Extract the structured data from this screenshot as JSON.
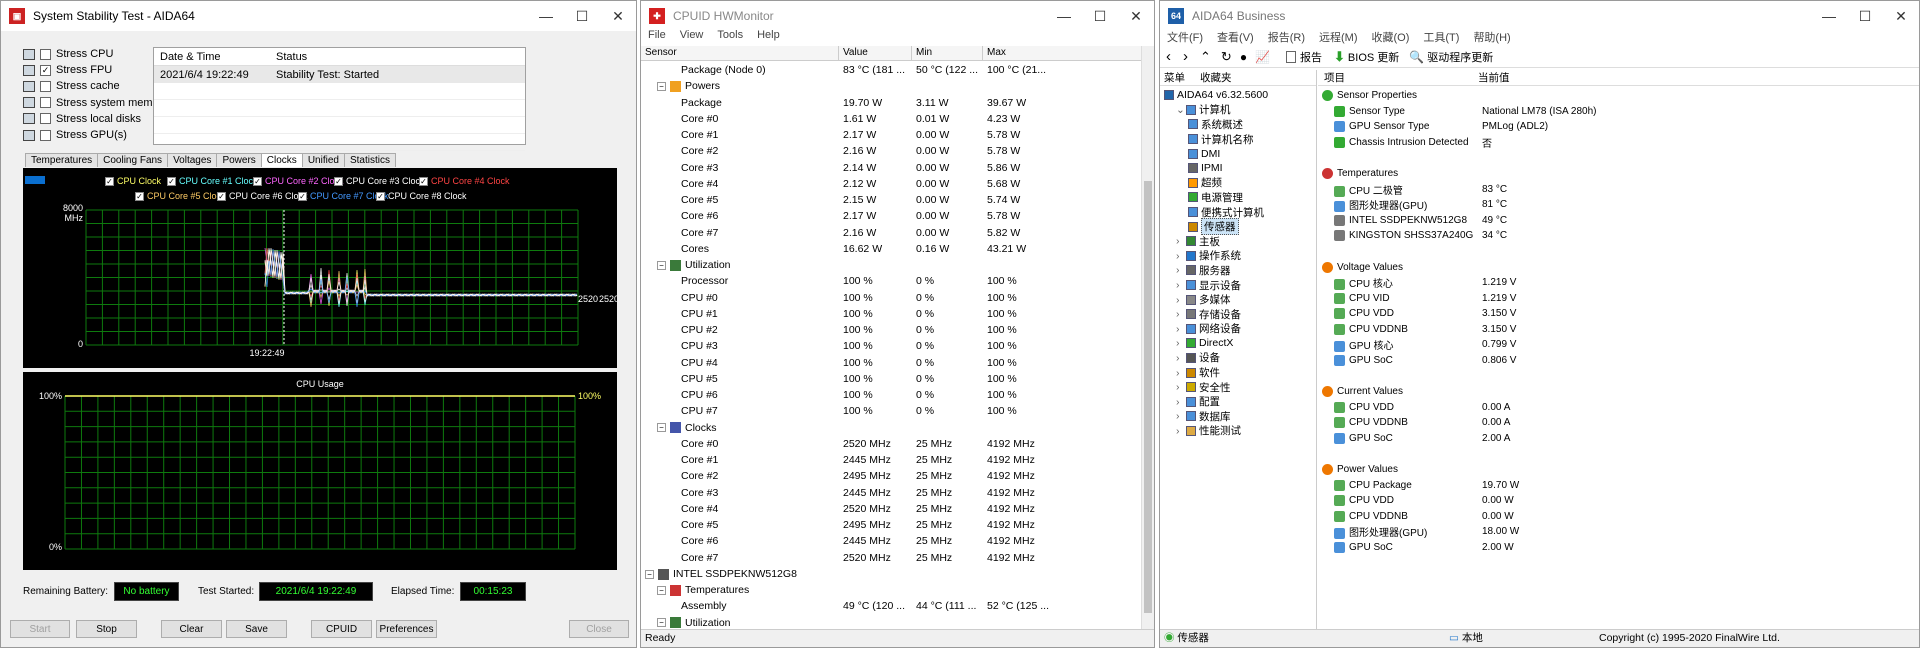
{
  "stability": {
    "title": "System Stability Test - AIDA64",
    "stress_items": [
      {
        "label": "Stress CPU",
        "checked": false
      },
      {
        "label": "Stress FPU",
        "checked": true
      },
      {
        "label": "Stress cache",
        "checked": false
      },
      {
        "label": "Stress system memory",
        "checked": false
      },
      {
        "label": "Stress local disks",
        "checked": false
      },
      {
        "label": "Stress GPU(s)",
        "checked": false
      }
    ],
    "log_header": {
      "datetime": "Date & Time",
      "status": "Status"
    },
    "log_row": {
      "datetime": "2021/6/4 19:22:49",
      "status": "Stability Test: Started"
    },
    "tabs": [
      "Temperatures",
      "Cooling Fans",
      "Voltages",
      "Powers",
      "Clocks",
      "Unified",
      "Statistics"
    ],
    "active_tab": "Clocks",
    "legend": [
      {
        "label": "CPU Clock",
        "color": "#ffff66"
      },
      {
        "label": "CPU Core #1 Clock",
        "color": "#66ffff"
      },
      {
        "label": "CPU Core #2 Clock",
        "color": "#ff66ff"
      },
      {
        "label": "CPU Core #3 Clock",
        "color": "#ffffff"
      },
      {
        "label": "CPU Core #4 Clock",
        "color": "#ff4444"
      },
      {
        "label": "CPU Core #5 Clock",
        "color": "#ffcc66"
      },
      {
        "label": "CPU Core #6 Clock",
        "color": "#ffffff"
      },
      {
        "label": "CPU Core #7 Clock",
        "color": "#4499ff"
      },
      {
        "label": "CPU Core #8 Clock",
        "color": "#ffffff"
      }
    ],
    "clock_graph": {
      "ymax": "8000",
      "unit": "MHz",
      "ymin": "0",
      "time": "19:22:49",
      "value": "2520",
      "value2": "2520"
    },
    "usage_graph": {
      "title": "CPU Usage",
      "top_left": "100%",
      "top_right": "100%",
      "bottom_left": "0%"
    },
    "remaining_battery_label": "Remaining Battery:",
    "remaining_battery": "No battery",
    "test_started_label": "Test Started:",
    "test_started": "2021/6/4 19:22:49",
    "elapsed_label": "Elapsed Time:",
    "elapsed": "00:15:23",
    "buttons": {
      "start": "Start",
      "stop": "Stop",
      "clear": "Clear",
      "save": "Save",
      "cpuid": "CPUID",
      "preferences": "Preferences",
      "close": "Close"
    }
  },
  "hwmonitor": {
    "title": "CPUID HWMonitor",
    "menu": [
      "File",
      "View",
      "Tools",
      "Help"
    ],
    "columns": [
      "Sensor",
      "Value",
      "Min",
      "Max"
    ],
    "rows": [
      {
        "indent": 3,
        "name": "Package (Node 0)",
        "value": "83 °C (181 ...",
        "min": "50 °C (122 ...",
        "max": "100 °C (21..."
      },
      {
        "indent": 1,
        "group": true,
        "icon": "power",
        "name": "Powers"
      },
      {
        "indent": 3,
        "name": "Package",
        "value": "19.70 W",
        "min": "3.11 W",
        "max": "39.67 W"
      },
      {
        "indent": 3,
        "name": "Core #0",
        "value": "1.61 W",
        "min": "0.01 W",
        "max": "4.23 W"
      },
      {
        "indent": 3,
        "name": "Core #1",
        "value": "2.17 W",
        "min": "0.00 W",
        "max": "5.78 W"
      },
      {
        "indent": 3,
        "name": "Core #2",
        "value": "2.16 W",
        "min": "0.00 W",
        "max": "5.78 W"
      },
      {
        "indent": 3,
        "name": "Core #3",
        "value": "2.14 W",
        "min": "0.00 W",
        "max": "5.86 W"
      },
      {
        "indent": 3,
        "name": "Core #4",
        "value": "2.12 W",
        "min": "0.00 W",
        "max": "5.68 W"
      },
      {
        "indent": 3,
        "name": "Core #5",
        "value": "2.15 W",
        "min": "0.00 W",
        "max": "5.74 W"
      },
      {
        "indent": 3,
        "name": "Core #6",
        "value": "2.17 W",
        "min": "0.00 W",
        "max": "5.78 W"
      },
      {
        "indent": 3,
        "name": "Core #7",
        "value": "2.16 W",
        "min": "0.00 W",
        "max": "5.82 W"
      },
      {
        "indent": 3,
        "name": "Cores",
        "value": "16.62 W",
        "min": "0.16 W",
        "max": "43.21 W"
      },
      {
        "indent": 1,
        "group": true,
        "icon": "util",
        "name": "Utilization"
      },
      {
        "indent": 3,
        "name": "Processor",
        "value": "100 %",
        "min": "0 %",
        "max": "100 %"
      },
      {
        "indent": 3,
        "name": "CPU #0",
        "value": "100 %",
        "min": "0 %",
        "max": "100 %"
      },
      {
        "indent": 3,
        "name": "CPU #1",
        "value": "100 %",
        "min": "0 %",
        "max": "100 %"
      },
      {
        "indent": 3,
        "name": "CPU #2",
        "value": "100 %",
        "min": "0 %",
        "max": "100 %"
      },
      {
        "indent": 3,
        "name": "CPU #3",
        "value": "100 %",
        "min": "0 %",
        "max": "100 %"
      },
      {
        "indent": 3,
        "name": "CPU #4",
        "value": "100 %",
        "min": "0 %",
        "max": "100 %"
      },
      {
        "indent": 3,
        "name": "CPU #5",
        "value": "100 %",
        "min": "0 %",
        "max": "100 %"
      },
      {
        "indent": 3,
        "name": "CPU #6",
        "value": "100 %",
        "min": "0 %",
        "max": "100 %"
      },
      {
        "indent": 3,
        "name": "CPU #7",
        "value": "100 %",
        "min": "0 %",
        "max": "100 %"
      },
      {
        "indent": 1,
        "group": true,
        "icon": "clock",
        "name": "Clocks"
      },
      {
        "indent": 3,
        "name": "Core #0",
        "value": "2520 MHz",
        "min": "25 MHz",
        "max": "4192 MHz"
      },
      {
        "indent": 3,
        "name": "Core #1",
        "value": "2445 MHz",
        "min": "25 MHz",
        "max": "4192 MHz"
      },
      {
        "indent": 3,
        "name": "Core #2",
        "value": "2495 MHz",
        "min": "25 MHz",
        "max": "4192 MHz"
      },
      {
        "indent": 3,
        "name": "Core #3",
        "value": "2445 MHz",
        "min": "25 MHz",
        "max": "4192 MHz"
      },
      {
        "indent": 3,
        "name": "Core #4",
        "value": "2520 MHz",
        "min": "25 MHz",
        "max": "4192 MHz"
      },
      {
        "indent": 3,
        "name": "Core #5",
        "value": "2495 MHz",
        "min": "25 MHz",
        "max": "4192 MHz"
      },
      {
        "indent": 3,
        "name": "Core #6",
        "value": "2445 MHz",
        "min": "25 MHz",
        "max": "4192 MHz"
      },
      {
        "indent": 3,
        "name": "Core #7",
        "value": "2520 MHz",
        "min": "25 MHz",
        "max": "4192 MHz"
      },
      {
        "indent": 0,
        "group": true,
        "icon": "disk",
        "name": "INTEL SSDPEKNW512G8"
      },
      {
        "indent": 1,
        "group": true,
        "icon": "temp",
        "name": "Temperatures"
      },
      {
        "indent": 3,
        "name": "Assembly",
        "value": "49 °C (120 ...",
        "min": "44 °C (111 ...",
        "max": "52 °C (125 ..."
      },
      {
        "indent": 1,
        "group": true,
        "icon": "util",
        "name": "Utilization"
      }
    ],
    "status": "Ready"
  },
  "aida": {
    "title": "AIDA64 Business",
    "menu": [
      "文件(F)",
      "查看(V)",
      "报告(R)",
      "远程(M)",
      "收藏(O)",
      "工具(T)",
      "帮助(H)"
    ],
    "toolbar": {
      "report": "报告",
      "bios": "BIOS 更新",
      "driver": "驱动程序更新"
    },
    "tree_tabs": [
      "菜单",
      "收藏夹"
    ],
    "tree": [
      {
        "indent": 0,
        "name": "AIDA64 v6.32.5600",
        "color": "#2266aa"
      },
      {
        "indent": 1,
        "name": "计算机",
        "color": "#4a90d9",
        "exp": "-"
      },
      {
        "indent": 2,
        "name": "系统概述",
        "color": "#4a90d9"
      },
      {
        "indent": 2,
        "name": "计算机名称",
        "color": "#4a90d9"
      },
      {
        "indent": 2,
        "name": "DMI",
        "color": "#4a90d9"
      },
      {
        "indent": 2,
        "name": "IPMI",
        "color": "#666666"
      },
      {
        "indent": 2,
        "name": "超频",
        "color": "#ff9900"
      },
      {
        "indent": 2,
        "name": "电源管理",
        "color": "#33aa33"
      },
      {
        "indent": 2,
        "name": "便携式计算机",
        "color": "#4a90d9"
      },
      {
        "indent": 2,
        "name": "传感器",
        "color": "#cc8800",
        "selected": true
      },
      {
        "indent": 1,
        "name": "主板",
        "color": "#338833",
        "exp": ">"
      },
      {
        "indent": 1,
        "name": "操作系统",
        "color": "#2277cc",
        "exp": ">"
      },
      {
        "indent": 1,
        "name": "服务器",
        "color": "#666666",
        "exp": ">"
      },
      {
        "indent": 1,
        "name": "显示设备",
        "color": "#4a90d9",
        "exp": ">"
      },
      {
        "indent": 1,
        "name": "多媒体",
        "color": "#888888",
        "exp": ">"
      },
      {
        "indent": 1,
        "name": "存储设备",
        "color": "#777777",
        "exp": ">"
      },
      {
        "indent": 1,
        "name": "网络设备",
        "color": "#4a90d9",
        "exp": ">"
      },
      {
        "indent": 1,
        "name": "DirectX",
        "color": "#33aa33",
        "exp": ">"
      },
      {
        "indent": 1,
        "name": "设备",
        "color": "#555555",
        "exp": ">"
      },
      {
        "indent": 1,
        "name": "软件",
        "color": "#cc8800",
        "exp": ">"
      },
      {
        "indent": 1,
        "name": "安全性",
        "color": "#ccaa00",
        "exp": ">"
      },
      {
        "indent": 1,
        "name": "配置",
        "color": "#4a90d9",
        "exp": ">"
      },
      {
        "indent": 1,
        "name": "数据库",
        "color": "#4a90d9",
        "exp": ">"
      },
      {
        "indent": 1,
        "name": "性能测试",
        "color": "#ddaa44",
        "exp": ">"
      }
    ],
    "columns": [
      "项目",
      "当前值"
    ],
    "sections": [
      {
        "title": "Sensor Properties",
        "icon_color": "#33aa33",
        "rows": [
          {
            "f": "Sensor Type",
            "v": "National LM78  (ISA 280h)",
            "c": "#33aa33"
          },
          {
            "f": "GPU Sensor Type",
            "v": "PMLog  (ADL2)",
            "c": "#4a90d9"
          },
          {
            "f": "Chassis Intrusion Detected",
            "v": "否",
            "c": "#33aa33"
          }
        ]
      },
      {
        "title": "Temperatures",
        "icon_color": "#cc3333",
        "rows": [
          {
            "f": "CPU 二极管",
            "v": "83 °C",
            "c": "#55aa55"
          },
          {
            "f": "图形处理器(GPU)",
            "v": "81 °C",
            "c": "#4a90d9"
          },
          {
            "f": "INTEL SSDPEKNW512G8",
            "v": "49 °C",
            "c": "#777777"
          },
          {
            "f": "KINGSTON SHSS37A240G",
            "v": "34 °C",
            "c": "#777777"
          }
        ]
      },
      {
        "title": "Voltage Values",
        "icon_color": "#ee7700",
        "rows": [
          {
            "f": "CPU 核心",
            "v": "1.219 V",
            "c": "#55aa55"
          },
          {
            "f": "CPU VID",
            "v": "1.219 V",
            "c": "#55aa55"
          },
          {
            "f": "CPU VDD",
            "v": "3.150 V",
            "c": "#55aa55"
          },
          {
            "f": "CPU VDDNB",
            "v": "3.150 V",
            "c": "#55aa55"
          },
          {
            "f": "GPU 核心",
            "v": "0.799 V",
            "c": "#4a90d9"
          },
          {
            "f": "GPU SoC",
            "v": "0.806 V",
            "c": "#4a90d9"
          }
        ]
      },
      {
        "title": "Current Values",
        "icon_color": "#ee7700",
        "rows": [
          {
            "f": "CPU VDD",
            "v": "0.00 A",
            "c": "#55aa55"
          },
          {
            "f": "CPU VDDNB",
            "v": "0.00 A",
            "c": "#55aa55"
          },
          {
            "f": "GPU SoC",
            "v": "2.00 A",
            "c": "#4a90d9"
          }
        ]
      },
      {
        "title": "Power Values",
        "icon_color": "#ee7700",
        "rows": [
          {
            "f": "CPU Package",
            "v": "19.70 W",
            "c": "#55aa55"
          },
          {
            "f": "CPU VDD",
            "v": "0.00 W",
            "c": "#55aa55"
          },
          {
            "f": "CPU VDDNB",
            "v": "0.00 W",
            "c": "#55aa55"
          },
          {
            "f": "图形处理器(GPU)",
            "v": "18.00 W",
            "c": "#4a90d9"
          },
          {
            "f": "GPU SoC",
            "v": "2.00 W",
            "c": "#4a90d9"
          }
        ]
      }
    ],
    "status_left": "传感器",
    "status_mid": "本地",
    "status_right": "Copyright (c) 1995-2020 FinalWire Ltd."
  }
}
